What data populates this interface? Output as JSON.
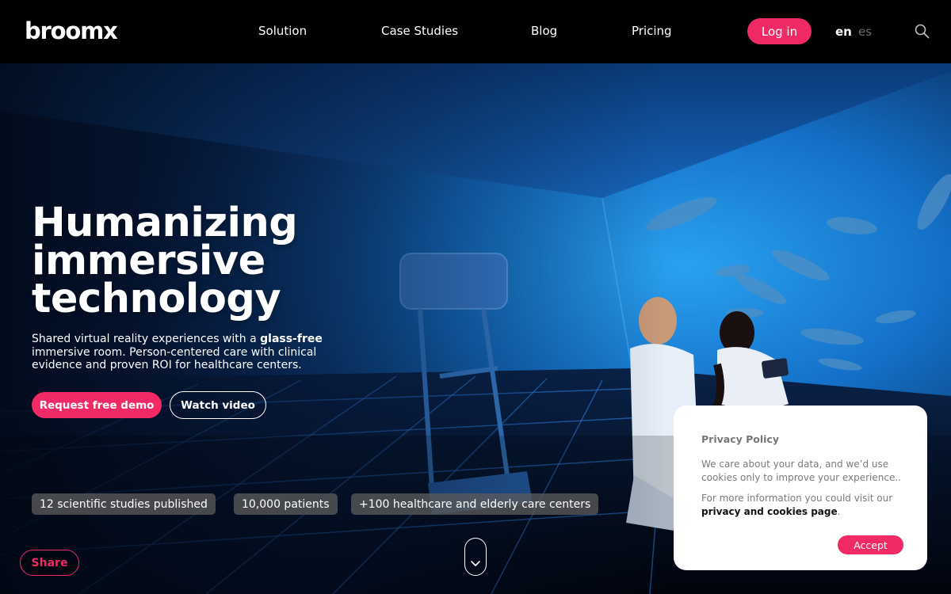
{
  "header": {
    "logo": "broomx",
    "nav": [
      "Solution",
      "Case Studies",
      "Blog",
      "Pricing"
    ],
    "login_label": "Log in",
    "lang_en": "en",
    "lang_es": "es"
  },
  "hero": {
    "headline": [
      "Humanizing",
      "immersive",
      "technology"
    ],
    "subtext_before": "Shared virtual reality experiences with a ",
    "subtext_bold": "glass-free",
    "subtext_after": " immersive room. Person-centered care with clinical evidence and proven ROI for healthcare centers.",
    "demo_label": "Request free demo",
    "video_label": "Watch video",
    "stats": [
      "12 scientific studies published",
      "10,000 patients",
      "+100 healthcare and elderly care centers"
    ],
    "share_label": "Share"
  },
  "cookie": {
    "title": "Privacy Policy",
    "p1": "We care about your data, and we’d use cookies only to improve your experience..",
    "p2_before": "For more information you could visit our ",
    "p2_link": "privacy and cookies page",
    "p2_after": ".",
    "accept_label": "Accept"
  },
  "colors": {
    "accent": "#ef2a64",
    "header_bg": "#000000",
    "hero_blue": "#1a78d8"
  },
  "icons": [
    "search-icon",
    "chevron-down-icon"
  ]
}
